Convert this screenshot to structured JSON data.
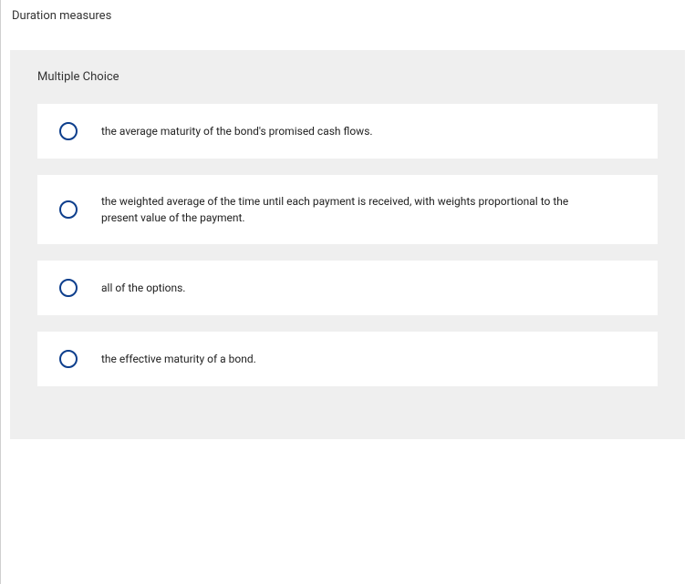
{
  "question": {
    "title": "Duration measures",
    "type_label": "Multiple Choice",
    "options": [
      {
        "text": "the average maturity of the bond's promised cash flows."
      },
      {
        "text": "the weighted average of the time until each payment is received, with weights proportional to the present value of the payment."
      },
      {
        "text": "all of the options."
      },
      {
        "text": "the effective maturity of a bond."
      }
    ]
  }
}
